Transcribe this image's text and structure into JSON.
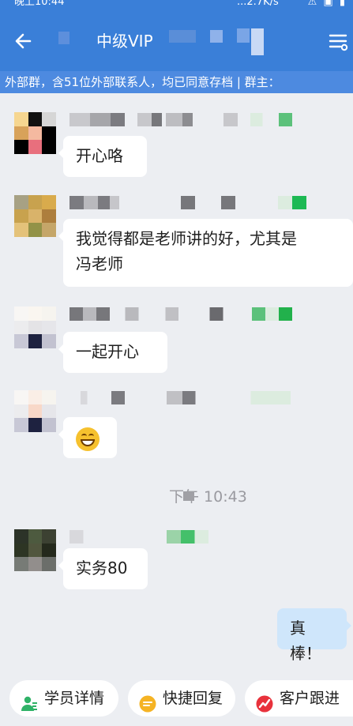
{
  "status_bar": {
    "time": "晚上10:44",
    "network_speed": "...2.7K/s"
  },
  "header": {
    "title": "中级VIP"
  },
  "banner": {
    "text": "外部群，含51位外部联系人，均已同意存档 | 群主："
  },
  "messages": [
    {
      "text": "开心咯"
    },
    {
      "text_line1": "我觉得都是老师讲的好，尤其是",
      "text_line2": "冯老师"
    },
    {
      "text": "一起开心"
    },
    {
      "emoji": "grinning-face"
    },
    {
      "text": "实务80"
    },
    {
      "text": "真棒！",
      "mine": true
    }
  ],
  "timestamp": "下午 10:43",
  "bottom_bar": {
    "student_details": "学员详情",
    "quick_reply": "快捷回复",
    "customer_follow": "客户跟进"
  },
  "colors": {
    "header": "#3a7fd8",
    "banner": "#4d8ae0",
    "background": "#eceef2",
    "my_bubble": "#cfe6fb"
  }
}
